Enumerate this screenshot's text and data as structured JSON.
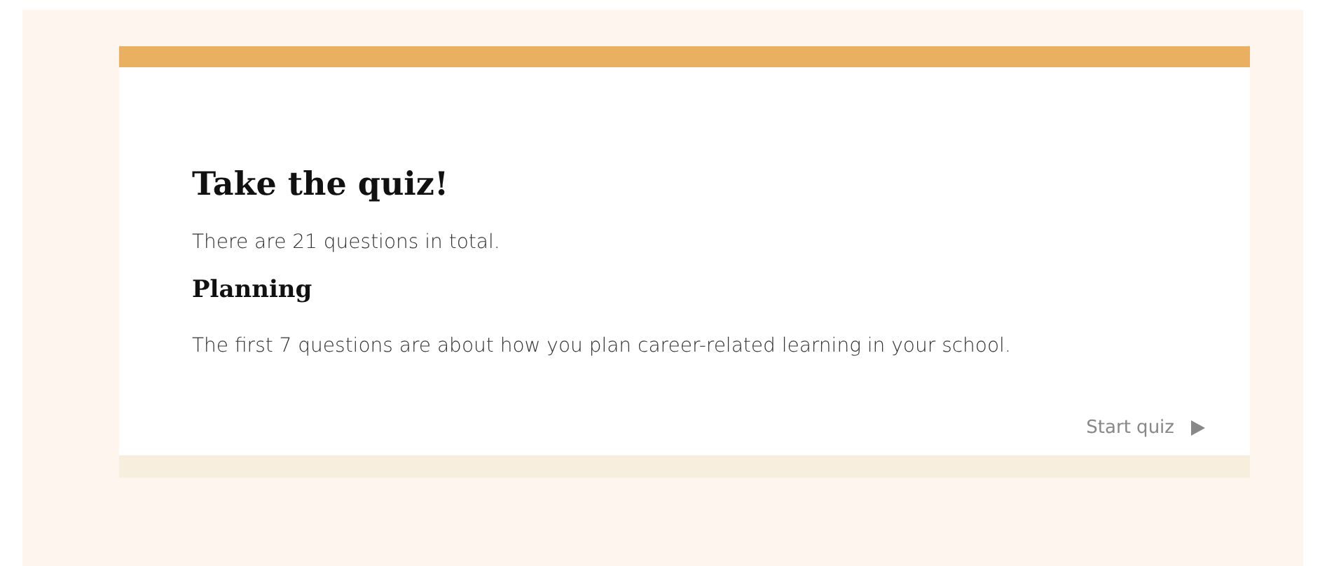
{
  "quiz_card": {
    "title": "Take the quiz!",
    "intro": "There are 21 questions in total.",
    "section_heading": "Planning",
    "section_text": "The first 7 questions are about how you plan career-related learning in your school.",
    "start_button": "Start quiz"
  }
}
